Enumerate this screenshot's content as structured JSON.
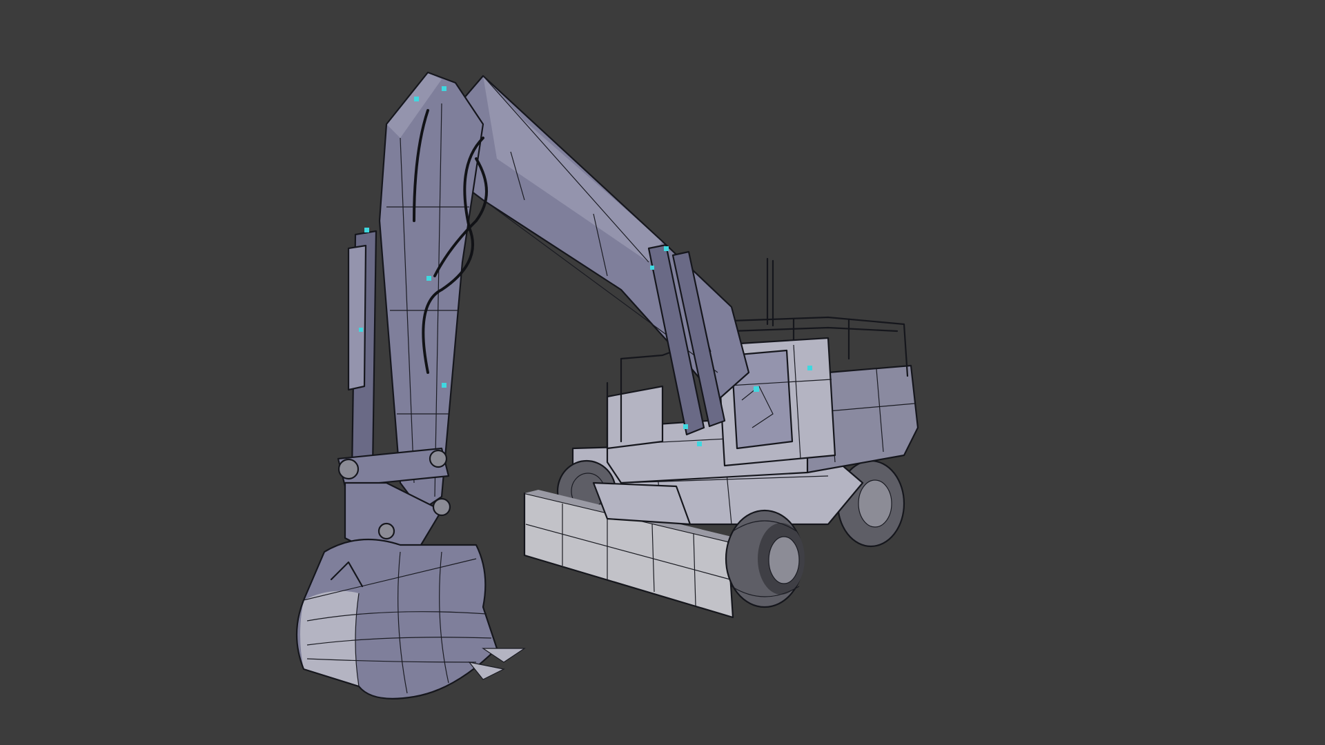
{
  "scene": {
    "subject": "wheeled-excavator-wireframe-model",
    "colors": {
      "background": "#3c3c3c",
      "model_base": "#7f7f9b",
      "wire": "#15161c",
      "highlight": "#3fd8e0"
    }
  }
}
